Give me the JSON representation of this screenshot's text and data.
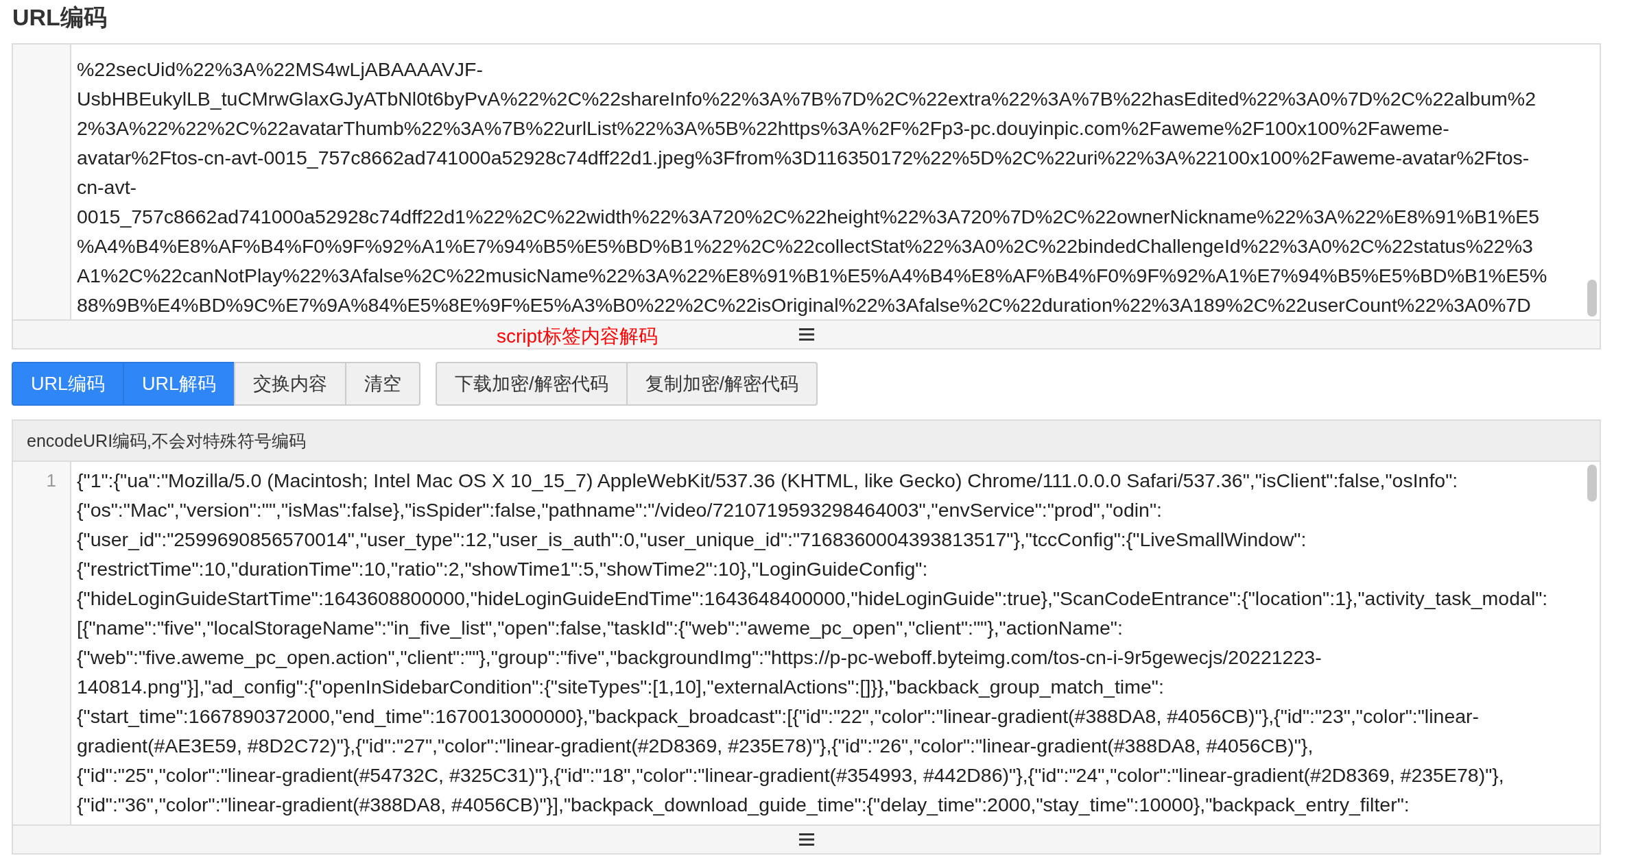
{
  "page_title": "URL编码",
  "source_editor": {
    "lines": [
      "%22secUid%22%3A%22MS4wLjABAAAAVJF-",
      "UsbHBEukylLB_tuCMrwGlaxGJyATbNl0t6byPvA%22%2C%22shareInfo%22%3A%7B%7D%2C%22extra%22%3A%7B%22hasEdited%22%3A0%7D%2C%22album%2",
      "2%3A%22%22%2C%22avatarThumb%22%3A%7B%22urlList%22%3A%5B%22https%3A%2F%2Fp3-pc.douyinpic.com%2Faweme%2F100x100%2Faweme-",
      "avatar%2Ftos-cn-avt-0015_757c8662ad741000a52928c74dff22d1.jpeg%3Ffrom%3D116350172%22%5D%2C%22uri%22%3A%22100x100%2Faweme-avatar%2Ftos-",
      "cn-avt-",
      "0015_757c8662ad741000a52928c74dff22d1%22%2C%22width%22%3A720%2C%22height%22%3A720%7D%2C%22ownerNickname%22%3A%22%E8%91%B1%E5",
      "%A4%B4%E8%AF%B4%F0%9F%92%A1%E7%94%B5%E5%BD%B1%22%2C%22collectStat%22%3A0%2C%22bindedChallengeId%22%3A0%2C%22status%22%3",
      "A1%2C%22canNotPlay%22%3Afalse%2C%22musicName%22%3A%22%E8%91%B1%E5%A4%B4%E8%AF%B4%F0%9F%92%A1%E7%94%B5%E5%BD%B1%E5%",
      "88%9B%E4%BD%9C%E7%9A%84%E5%8E%9F%E5%A3%B0%22%2C%22isOriginal%22%3Afalse%2C%22duration%22%3A189%2C%22userCount%22%3A0%7D"
    ],
    "footer_label": "script标签内容解码"
  },
  "button_groups": [
    [
      {
        "label": "URL编码",
        "kind": "primary"
      },
      {
        "label": "URL解码",
        "kind": "primary"
      },
      {
        "label": "交换内容",
        "kind": "default"
      },
      {
        "label": "清空",
        "kind": "default"
      }
    ],
    [
      {
        "label": "下载加密/解密代码",
        "kind": "default"
      },
      {
        "label": "复制加密/解密代码",
        "kind": "default"
      }
    ]
  ],
  "result_panel": {
    "header": "encodeURI编码,不会对特殊符号编码",
    "line_numbers": [
      "1"
    ],
    "lines": [
      "{\"1\":{\"ua\":\"Mozilla/5.0 (Macintosh; Intel Mac OS X 10_15_7) AppleWebKit/537.36 (KHTML, like Gecko) Chrome/111.0.0.0 Safari/537.36\",\"isClient\":false,\"osInfo\":",
      "{\"os\":\"Mac\",\"version\":\"\",\"isMas\":false},\"isSpider\":false,\"pathname\":\"/video/7210719593298464003\",\"envService\":\"prod\",\"odin\":",
      "{\"user_id\":\"2599690856570014\",\"user_type\":12,\"user_is_auth\":0,\"user_unique_id\":\"7168360004393813517\"},\"tccConfig\":{\"LiveSmallWindow\":",
      "{\"restrictTime\":10,\"durationTime\":10,\"ratio\":2,\"showTime1\":5,\"showTime2\":10},\"LoginGuideConfig\":",
      "{\"hideLoginGuideStartTime\":1643608800000,\"hideLoginGuideEndTime\":1643648400000,\"hideLoginGuide\":true},\"ScanCodeEntrance\":{\"location\":1},\"activity_task_modal\":",
      "[{\"name\":\"five\",\"localStorageName\":\"in_five_list\",\"open\":false,\"taskId\":{\"web\":\"aweme_pc_open\",\"client\":\"\"},\"actionName\":",
      "{\"web\":\"five.aweme_pc_open.action\",\"client\":\"\"},\"group\":\"five\",\"backgroundImg\":\"https://p-pc-weboff.byteimg.com/tos-cn-i-9r5gewecjs/20221223-",
      "140814.png\"}],\"ad_config\":{\"openInSidebarCondition\":{\"siteTypes\":[1,10],\"externalActions\":[]}},\"backback_group_match_time\":",
      "{\"start_time\":1667890372000,\"end_time\":1670013000000},\"backpack_broadcast\":[{\"id\":\"22\",\"color\":\"linear-gradient(#388DA8, #4056CB)\"},{\"id\":\"23\",\"color\":\"linear-",
      "gradient(#AE3E59, #8D2C72)\"},{\"id\":\"27\",\"color\":\"linear-gradient(#2D8369, #235E78)\"},{\"id\":\"26\",\"color\":\"linear-gradient(#388DA8, #4056CB)\"},",
      "{\"id\":\"25\",\"color\":\"linear-gradient(#54732C, #325C31)\"},{\"id\":\"18\",\"color\":\"linear-gradient(#354993, #442D86)\"},{\"id\":\"24\",\"color\":\"linear-gradient(#2D8369, #235E78)\"},",
      "{\"id\":\"36\",\"color\":\"linear-gradient(#388DA8, #4056CB)\"}],\"backpack_download_guide_time\":{\"delay_time\":2000,\"stay_time\":10000},\"backpack_entry_filter\":"
    ]
  }
}
